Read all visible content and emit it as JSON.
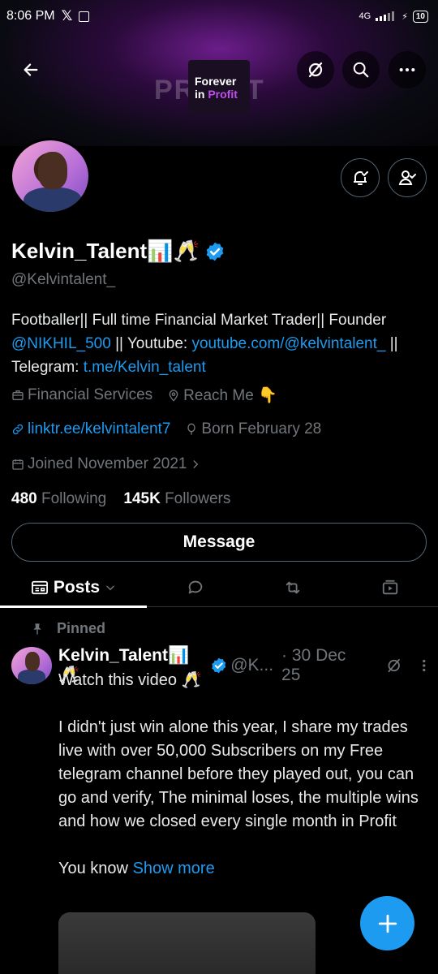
{
  "status_bar": {
    "time": "8:06 PM",
    "network": "4G",
    "battery": "10"
  },
  "banner": {
    "logo_line1": "Forever",
    "logo_line2_a": "in",
    "logo_line2_b": "Profit",
    "watermark": "PROFIT"
  },
  "profile": {
    "name": "Kelvin_Talent📊🥂",
    "handle": "@Kelvintalent_",
    "bio_text1": "Footballer|| Full time Financial Market Trader|| Founder ",
    "bio_link1": "@NIKHIL_500",
    "bio_text2": " || Youtube: ",
    "bio_link2": "youtube.com/@kelvintalent_",
    "bio_text3": " || Telegram: ",
    "bio_link3": "t.me/Kelvin_talent",
    "category": "Financial Services",
    "location": "Reach Me 👇",
    "website": "linktr.ee/kelvintalent7",
    "born": "Born February 28",
    "joined": "Joined November 2021",
    "following_count": "480",
    "following_label": "Following",
    "followers_count": "145K",
    "followers_label": "Followers",
    "message_label": "Message"
  },
  "tabs": {
    "posts_label": "Posts"
  },
  "pinned_post": {
    "pinned_label": "Pinned",
    "author_name": "Kelvin_Talent📊🥂",
    "author_handle": "@K...",
    "date": "· 30 Dec 25",
    "text": "Watch this video 🥂\n\nI didn't just win alone this year, I share my trades live with over 50,000 Subscribers on my Free telegram channel before they played out, you can go and verify, The minimal loses, the multiple wins and how we closed every single month in Profit\n\nYou know ",
    "show_more": "Show more"
  },
  "colors": {
    "accent": "#1d9bf0",
    "secondary_text": "#71767b",
    "background": "#000000"
  }
}
